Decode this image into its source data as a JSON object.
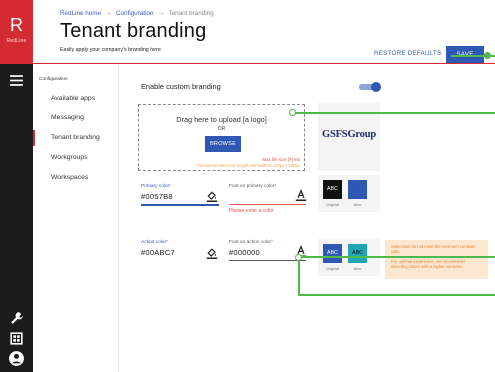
{
  "brand": {
    "letter": "R",
    "name": "RedLine"
  },
  "breadcrumb": {
    "home": "RedLine home",
    "configuration": "Configuration",
    "current": "Tenant branding",
    "separator": "→"
  },
  "header": {
    "title": "Tenant branding",
    "subtitle": "Easily apply your company's branding here",
    "restore_label": "RESTORE DEFAULTS",
    "save_label": "SAVE"
  },
  "rail_icons": [
    "menu-icon",
    "wrench-icon",
    "grid-icon",
    "account-icon"
  ],
  "subnav": {
    "heading": "Configuration",
    "items": [
      {
        "label": "Available apps",
        "active": false
      },
      {
        "label": "Messaging",
        "active": false
      },
      {
        "label": "Tenant branding",
        "active": true
      },
      {
        "label": "Workgroups",
        "active": false
      },
      {
        "label": "Workspaces",
        "active": false
      }
    ]
  },
  "branding": {
    "enable_label": "Enable custom branding",
    "enabled": true,
    "upload": {
      "prompt": "Drag here to upload [a logo]",
      "or": "OR",
      "browse_label": "BROWSE",
      "max_size": "Max file size [#] mb",
      "recommended": "Recommended max height and width is 100px x 100px"
    },
    "logo_text": "GSFSGroup"
  },
  "primary": {
    "label": "Primary color",
    "value": "#0057B8",
    "font_label": "Font on primary color",
    "font_value": "",
    "font_error": "Please enter a color",
    "swatch_text": "ABC",
    "original_label": "Original",
    "new_label": "New",
    "original_color": "#111111",
    "new_color": "#2e58b4"
  },
  "action": {
    "label": "Action color",
    "value": "#00ABC7",
    "font_label": "Font on action color",
    "font_value": "#000000",
    "swatch_text_original": "ABC",
    "swatch_text_new": "ABC",
    "original_label": "Original",
    "new_label": "New",
    "original_color": "#2e58b4",
    "new_color": "#22a6b6"
  },
  "warning": {
    "line1": "Selections do not meet the minimum contrast ratio.",
    "line2": "For optimal experience, we recommend selecting colors with a higher contrast."
  },
  "colors": {
    "brand_red": "#d42a31",
    "accent_blue": "#2e58b4",
    "annotation_green": "#4fba4c",
    "error_red": "#e0544c",
    "warning_bg": "#fde7d0"
  }
}
